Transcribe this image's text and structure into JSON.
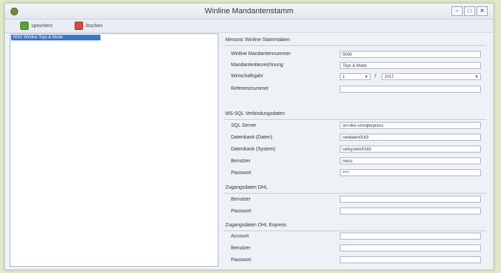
{
  "window": {
    "title": "Winline Mandantenstamm",
    "controls": {
      "minimize": "–",
      "maximize": "□",
      "close": "✕"
    }
  },
  "toolbar": {
    "save_label": "speichern",
    "delete_label": "löschen"
  },
  "list": {
    "items": [
      {
        "label": "0001 Winline Toys & Mode"
      }
    ]
  },
  "sections": {
    "winline": {
      "title": "Mesonic Winline Stammdaten",
      "mandant_nr_label": "Winline Mandantennummer",
      "mandant_nr_value": "5000",
      "bezeichnung_label": "Mandantenbezeichnung",
      "bezeichnung_value": "Toys & Mode",
      "wj_label": "Wirtschaftsjahr",
      "wj_month": "1",
      "wj_sep": "/",
      "wj_year": "2017",
      "referenz_label": "Referenznummer",
      "referenz_value": ""
    },
    "mssql": {
      "title": "MS-SQL Verbindungsdaten",
      "server_label": "SQL Server",
      "server_value": "srv-dev-sn\\sqlexpress",
      "db_daten_label": "Datenbank (Daten)",
      "db_daten_value": "cwldaten0163",
      "db_system_label": "Datenbank (System)",
      "db_system_value": "cwlsystem0163",
      "user_label": "Benutzer",
      "user_value": "mesc",
      "pass_label": "Passwort",
      "pass_value": "****"
    },
    "dhl": {
      "title": "Zugangsdaten DHL",
      "user_label": "Benutzer",
      "user_value": "",
      "pass_label": "Passwort",
      "pass_value": ""
    },
    "dhl_express": {
      "title": "Zugangsdaten DHL Express",
      "account_label": "Account",
      "account_value": "",
      "user_label": "Benutzer",
      "user_value": "",
      "pass_label": "Passwort",
      "pass_value": ""
    }
  },
  "colors": {
    "accent": "#3d74c9",
    "save": "#57a43a",
    "delete": "#d94848",
    "page_background": "#dfe9c8"
  }
}
